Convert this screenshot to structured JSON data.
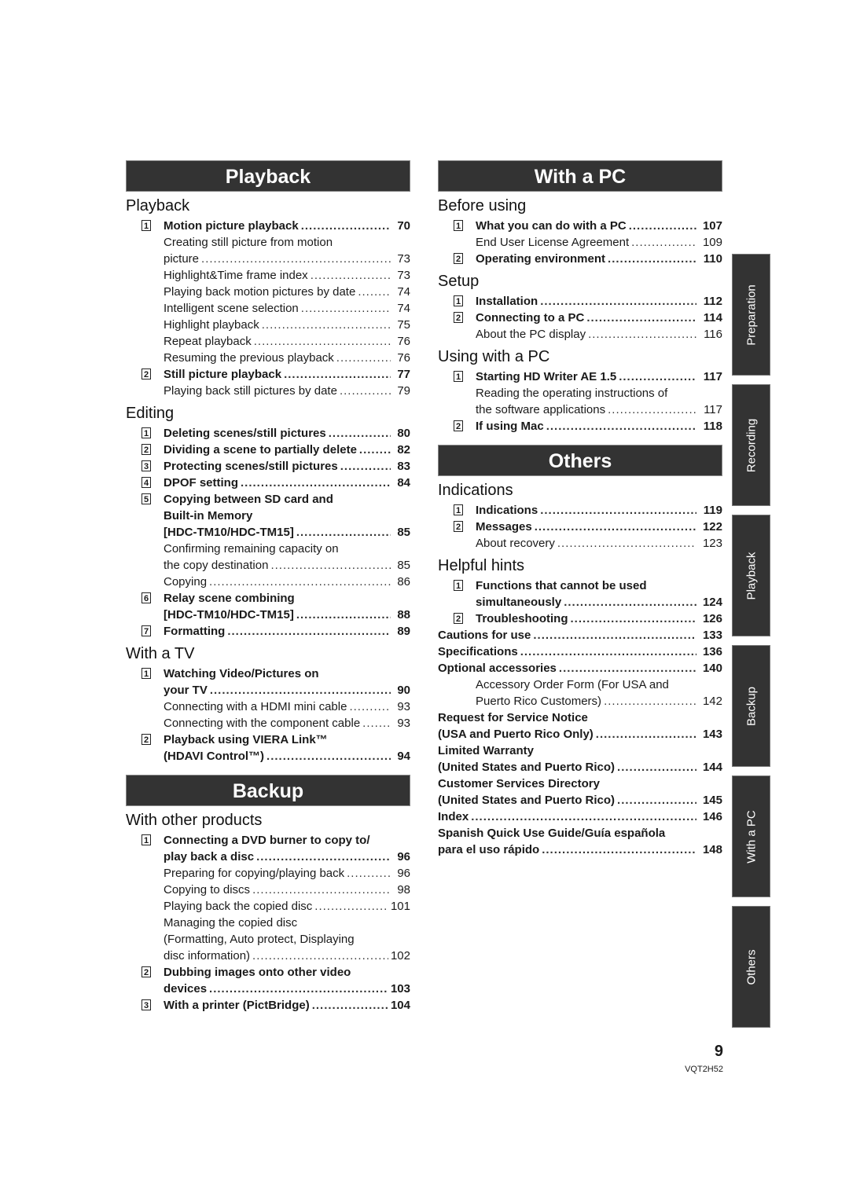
{
  "left_column": {
    "banner_playback": "Playback",
    "playback": {
      "title": "Playback",
      "entries": [
        {
          "num": "1",
          "text": "Motion picture playback",
          "page": "70"
        },
        {
          "wrap": "Creating still picture from motion",
          "text": "picture",
          "page": "73"
        },
        {
          "text": "Highlight&Time frame index",
          "page": "73"
        },
        {
          "text": "Playing back motion pictures by date",
          "page": "74"
        },
        {
          "text": "Intelligent scene selection",
          "page": "74"
        },
        {
          "text": "Highlight playback",
          "page": "75"
        },
        {
          "text": "Repeat playback",
          "page": "76"
        },
        {
          "text": "Resuming the previous playback",
          "page": "76"
        },
        {
          "num": "2",
          "text": "Still picture playback",
          "page": "77"
        },
        {
          "text": "Playing back still pictures by date",
          "page": "79"
        }
      ]
    },
    "editing": {
      "title": "Editing",
      "entries": [
        {
          "num": "1",
          "text": "Deleting scenes/still pictures",
          "page": "80"
        },
        {
          "num": "2",
          "text": "Dividing a scene to partially delete",
          "page": "82"
        },
        {
          "num": "3",
          "text": "Protecting scenes/still pictures",
          "page": "83"
        },
        {
          "num": "4",
          "text": "DPOF setting",
          "page": "84"
        },
        {
          "num": "5",
          "wrap": "Copying between SD card and",
          "wrap2": "Built-in Memory",
          "text": "[HDC-TM10/HDC-TM15]",
          "page": "85"
        },
        {
          "wrap": "Confirming remaining capacity on",
          "text": "the copy destination",
          "page": "85"
        },
        {
          "text": "Copying",
          "page": "86"
        },
        {
          "num": "6",
          "wrap": "Relay scene combining",
          "text": "[HDC-TM10/HDC-TM15]",
          "page": "88"
        },
        {
          "num": "7",
          "text": "Formatting",
          "page": "89"
        }
      ]
    },
    "with_tv": {
      "title": "With a TV",
      "entries": [
        {
          "num": "1",
          "wrap": "Watching Video/Pictures on",
          "text": "your TV",
          "page": "90"
        },
        {
          "text": "Connecting with a HDMI mini cable",
          "page": "93"
        },
        {
          "text": "Connecting with the component cable",
          "page": "93"
        },
        {
          "num": "2",
          "wrap": "Playback using VIERA Link™",
          "text": "(HDAVI Control™)",
          "page": "94"
        }
      ]
    },
    "banner_backup": "Backup",
    "other_products": {
      "title": "With other products",
      "entries": [
        {
          "num": "1",
          "wrap": "Connecting a DVD burner to copy to/",
          "text": "play back a disc",
          "page": "96"
        },
        {
          "text": "Preparing for copying/playing back",
          "page": "96"
        },
        {
          "text": "Copying to discs",
          "page": "98"
        },
        {
          "text": "Playing back the copied disc",
          "page": "101"
        },
        {
          "wrap": "Managing the copied disc",
          "wrap2": "(Formatting, Auto protect, Displaying",
          "text": "disc information)",
          "page": "102"
        },
        {
          "num": "2",
          "wrap": "Dubbing images onto other video",
          "text": "devices",
          "page": "103"
        },
        {
          "num": "3",
          "text": "With a printer (PictBridge)",
          "page": "104"
        }
      ]
    }
  },
  "right_column": {
    "banner_pc": "With a PC",
    "before_using": {
      "title": "Before using",
      "entries": [
        {
          "num": "1",
          "text": "What you can do with a PC",
          "page": "107"
        },
        {
          "text": "End User License Agreement",
          "page": "109"
        },
        {
          "num": "2",
          "text": "Operating environment",
          "page": "110"
        }
      ]
    },
    "setup": {
      "title": "Setup",
      "entries": [
        {
          "num": "1",
          "text": "Installation",
          "page": "112"
        },
        {
          "num": "2",
          "text": "Connecting to a PC",
          "page": "114"
        },
        {
          "text": "About the PC display",
          "page": "116"
        }
      ]
    },
    "using_pc": {
      "title": "Using with a PC",
      "entries": [
        {
          "num": "1",
          "text": "Starting HD Writer AE 1.5",
          "page": "117"
        },
        {
          "wrap": "Reading the operating instructions of",
          "text": "the software applications",
          "page": "117"
        },
        {
          "num": "2",
          "text": "If using Mac",
          "page": "118"
        }
      ]
    },
    "banner_others": "Others",
    "indications": {
      "title": "Indications",
      "entries": [
        {
          "num": "1",
          "text": "Indications",
          "page": "119"
        },
        {
          "num": "2",
          "text": "Messages",
          "page": "122"
        },
        {
          "text": "About recovery",
          "page": "123"
        }
      ]
    },
    "helpful_hints": {
      "title": "Helpful hints",
      "entries": [
        {
          "num": "1",
          "wrap": "Functions that cannot be used",
          "text": "simultaneously",
          "page": "124"
        },
        {
          "num": "2",
          "text": "Troubleshooting",
          "page": "126"
        }
      ]
    },
    "flush_entries": [
      {
        "text": "Cautions for use",
        "page": "133"
      },
      {
        "text": "Specifications",
        "page": "136"
      },
      {
        "text": "Optional accessories",
        "page": "140"
      },
      {
        "wrap": "Accessory Order Form (For USA and",
        "text": "Puerto Rico Customers)",
        "page": "142",
        "indent": true
      },
      {
        "wrap": "Request for Service Notice",
        "text": "(USA and Puerto Rico Only)",
        "page": "143"
      },
      {
        "wrap": "Limited Warranty",
        "text": "(United States and Puerto Rico)",
        "page": "144"
      },
      {
        "wrap": "Customer Services Directory",
        "text": "(United States and Puerto Rico)",
        "page": "145"
      },
      {
        "text": "Index",
        "page": "146"
      },
      {
        "wrap": "Spanish Quick Use Guide/Guía española",
        "text": "para el uso rápido",
        "page": "148"
      }
    ]
  },
  "side_tabs": [
    "Preparation",
    "Recording",
    "Playback",
    "Backup",
    "With a PC",
    "Others"
  ],
  "footer": {
    "page_number": "9",
    "doc_code": "VQT2H52"
  }
}
